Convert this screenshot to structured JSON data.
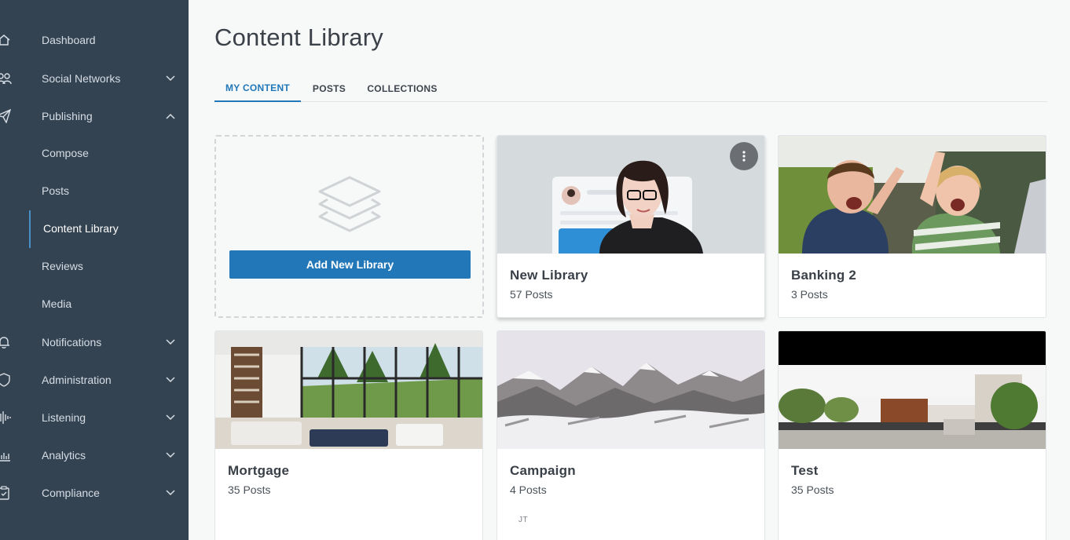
{
  "sidebar": {
    "items": [
      {
        "label": "Dashboard",
        "icon": "home-icon",
        "chevron": ""
      },
      {
        "label": "Social Networks",
        "icon": "users-icon",
        "chevron": "down"
      },
      {
        "label": "Publishing",
        "icon": "paper-plane-icon",
        "chevron": "up"
      },
      {
        "label": "Compose"
      },
      {
        "label": "Posts"
      },
      {
        "label": "Content Library"
      },
      {
        "label": "Reviews"
      },
      {
        "label": "Media"
      },
      {
        "label": "Notifications",
        "icon": "bell-icon",
        "chevron": "down"
      },
      {
        "label": "Administration",
        "icon": "shield-icon",
        "chevron": "down"
      },
      {
        "label": "Listening",
        "icon": "soundwave-icon",
        "chevron": "down"
      },
      {
        "label": "Analytics",
        "icon": "bar-chart-icon",
        "chevron": "down"
      },
      {
        "label": "Compliance",
        "icon": "clipboard-check-icon",
        "chevron": "down"
      }
    ]
  },
  "main": {
    "title": "Content Library",
    "tabs": [
      {
        "label": "MY CONTENT",
        "active": true
      },
      {
        "label": "POSTS",
        "active": false
      },
      {
        "label": "COLLECTIONS",
        "active": false
      }
    ],
    "add_library_label": "Add New Library",
    "libraries": [
      {
        "title": "New Library",
        "count": "57 Posts",
        "thumbnail": "woman-with-glasses"
      },
      {
        "title": "Banking 2",
        "count": "3 Posts",
        "thumbnail": "excited-kids"
      },
      {
        "title": "Mortgage",
        "count": "35 Posts",
        "thumbnail": "modern-living-room"
      },
      {
        "title": "Campaign",
        "count": "4 Posts",
        "thumbnail": "snowy-mountains",
        "initials": "JT"
      },
      {
        "title": "Test",
        "count": "35 Posts",
        "thumbnail": "modern-house"
      }
    ]
  },
  "colors": {
    "sidebar_bg": "#344352",
    "accent": "#2277b9",
    "page_bg": "#f7f8f8"
  }
}
